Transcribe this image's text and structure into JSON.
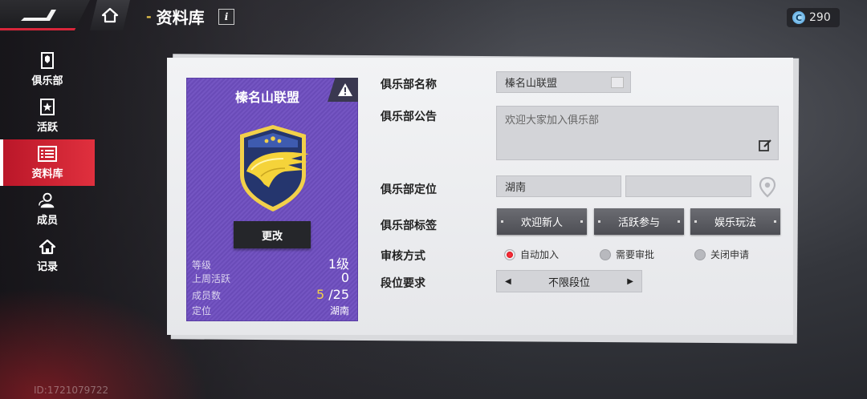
{
  "header": {
    "title": "资料库",
    "info": "i",
    "currency": "290"
  },
  "sidebar": {
    "items": [
      {
        "label": "俱乐部",
        "icon": "club-card-icon"
      },
      {
        "label": "活跃",
        "icon": "activity-star-icon"
      },
      {
        "label": "资料库",
        "icon": "database-icon",
        "active": true
      },
      {
        "label": "成员",
        "icon": "members-icon"
      },
      {
        "label": "记录",
        "icon": "home-record-icon"
      }
    ]
  },
  "uid": "ID:1721079722",
  "card": {
    "name": "榛名山联盟",
    "change_label": "更改",
    "stats": [
      {
        "label": "等级",
        "value": "1级"
      },
      {
        "label": "上周活跃",
        "value": "0"
      },
      {
        "label": "成员数",
        "value_current": "5",
        "value_max": "/25"
      },
      {
        "label": "定位",
        "value": "湖南"
      }
    ]
  },
  "form": {
    "name_label": "俱乐部名称",
    "name_value": "榛名山联盟",
    "notice_label": "俱乐部公告",
    "notice_value": "欢迎大家加入俱乐部",
    "location_label": "俱乐部定位",
    "location_value": "湖南",
    "location_value2": "",
    "tags_label": "俱乐部标签",
    "tags": [
      "欢迎新人",
      "活跃参与",
      "娱乐玩法"
    ],
    "review_label": "审核方式",
    "review_options": [
      {
        "label": "自动加入",
        "selected": true
      },
      {
        "label": "需要审批",
        "selected": false
      },
      {
        "label": "关闭申请",
        "selected": false
      }
    ],
    "rank_label": "段位要求",
    "rank_value": "不限段位"
  },
  "colors": {
    "accent": "#e0303e",
    "card": "#6a4bb8",
    "gold": "#f2d04a"
  }
}
